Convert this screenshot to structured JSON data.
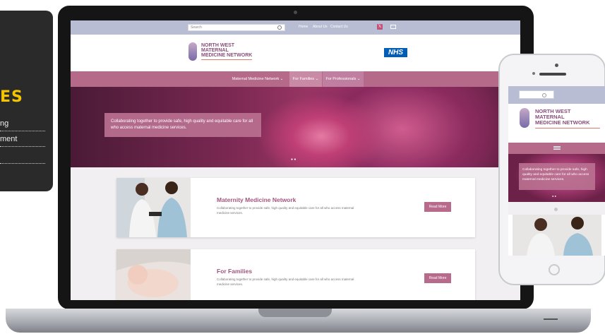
{
  "side_card": {
    "heading": "ES",
    "lines": [
      "ng",
      "ment",
      ""
    ]
  },
  "site": {
    "search_placeholder": "Search",
    "top_links": [
      "Home",
      "About Us",
      "Contact Us"
    ],
    "logo_lines": [
      "NORTH WEST",
      "MATERNAL",
      "MEDICINE NETWORK"
    ],
    "nhs_label": "NHS",
    "nav": [
      "Maternal Medicine Network ⌄",
      "For Families ⌄",
      "For Professionals ⌄"
    ],
    "hero_caption": "Collaborating together to provide safe, high quality and equitable care for all who access maternal medicine services.",
    "slider_dots": "● ●",
    "cards": [
      {
        "title": "Maternity Medicine Network",
        "desc": "Collaborating together to provide safe, high quality and equitable care for all who access maternal medicine services.",
        "button": "Read More"
      },
      {
        "title": "For Families",
        "desc": "Collaborating together to provide safe, high quality and equitable care for all who access maternal medicine services.",
        "button": "Read More"
      }
    ]
  },
  "phone": {
    "logo_lines": [
      "NORTH WEST",
      "MATERNAL",
      "MEDICINE NETWORK"
    ],
    "hero_caption": "Collaborating together to provide safe, high quality and equitable care for all who access maternal medicine services.",
    "slider_dots": "● ●"
  },
  "colors": {
    "accent": "#b56a8a",
    "top_bar": "#b9bdd3",
    "logo_text": "#8a4d7b",
    "nhs_blue": "#005eb8",
    "side_heading": "#f5c400"
  },
  "icons": [
    "search-icon",
    "x-social-icon",
    "mail-icon",
    "hamburger-menu-icon"
  ]
}
